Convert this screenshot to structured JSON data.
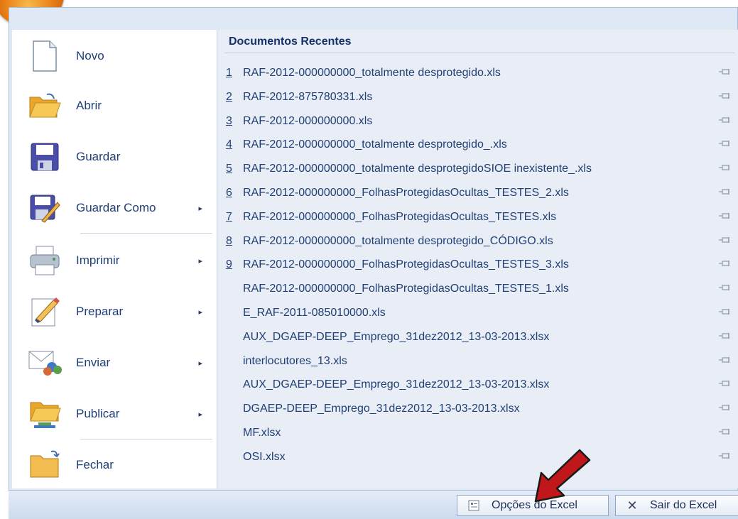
{
  "left_menu": {
    "items": [
      {
        "label": "Novo",
        "icon": "new-document-icon",
        "has_submenu": false
      },
      {
        "label": "Abrir",
        "icon": "open-folder-icon",
        "has_submenu": false
      },
      {
        "label": "Guardar",
        "icon": "save-disk-icon",
        "has_submenu": false
      },
      {
        "label": "Guardar Como",
        "icon": "save-as-icon",
        "has_submenu": true
      },
      {
        "label": "Imprimir",
        "icon": "printer-icon",
        "has_submenu": true
      },
      {
        "label": "Preparar",
        "icon": "prepare-document-icon",
        "has_submenu": true
      },
      {
        "label": "Enviar",
        "icon": "send-icon",
        "has_submenu": true
      },
      {
        "label": "Publicar",
        "icon": "publish-folder-icon",
        "has_submenu": true
      },
      {
        "label": "Fechar",
        "icon": "close-folder-icon",
        "has_submenu": false
      }
    ],
    "arrow_glyph": "▸"
  },
  "recent": {
    "title": "Documentos Recentes",
    "files": [
      {
        "num": "1",
        "name": "RAF-2012-000000000_totalmente desprotegido.xls"
      },
      {
        "num": "2",
        "name": "RAF-2012-875780331.xls"
      },
      {
        "num": "3",
        "name": "RAF-2012-000000000.xls"
      },
      {
        "num": "4",
        "name": "RAF-2012-000000000_totalmente desprotegido_.xls"
      },
      {
        "num": "5",
        "name": "RAF-2012-000000000_totalmente desprotegidoSIOE inexistente_.xls"
      },
      {
        "num": "6",
        "name": "RAF-2012-000000000_FolhasProtegidasOcultas_TESTES_2.xls"
      },
      {
        "num": "7",
        "name": "RAF-2012-000000000_FolhasProtegidasOcultas_TESTES.xls"
      },
      {
        "num": "8",
        "name": "RAF-2012-000000000_totalmente desprotegido_CÓDIGO.xls"
      },
      {
        "num": "9",
        "name": "RAF-2012-000000000_FolhasProtegidasOcultas_TESTES_3.xls"
      },
      {
        "num": "",
        "name": "RAF-2012-000000000_FolhasProtegidasOcultas_TESTES_1.xls"
      },
      {
        "num": "",
        "name": "E_RAF-2011-085010000.xls"
      },
      {
        "num": "",
        "name": "AUX_DGAEP-DEEP_Emprego_31dez2012_13-03-2013.xlsx"
      },
      {
        "num": "",
        "name": "interlocutores_13.xls"
      },
      {
        "num": "",
        "name": "AUX_DGAEP-DEEP_Emprego_31dez2012_13-03-2013.xlsx"
      },
      {
        "num": "",
        "name": "DGAEP-DEEP_Emprego_31dez2012_13-03-2013.xlsx"
      },
      {
        "num": "",
        "name": "MF.xlsx"
      },
      {
        "num": "",
        "name": "OSI.xlsx"
      }
    ]
  },
  "bottom": {
    "options_label": "Opções do Excel",
    "exit_label": "Sair do Excel",
    "exit_glyph": "✕"
  },
  "colors": {
    "accent_text": "#1f3f78",
    "arrow_red": "#c0181a",
    "pane_bg": "#e9eef6"
  }
}
